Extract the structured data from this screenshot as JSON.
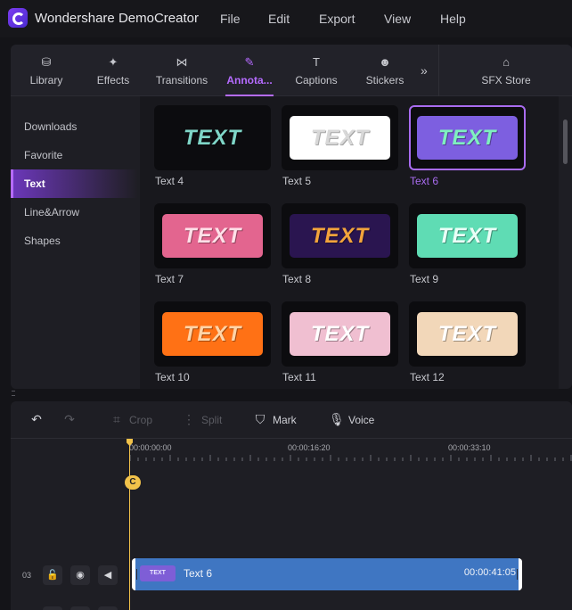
{
  "app": {
    "title": "Wondershare DemoCreator"
  },
  "menu": [
    "File",
    "Edit",
    "Export",
    "View",
    "Help"
  ],
  "tabs": [
    {
      "label": "Library",
      "icon": "layers-icon",
      "glyph": "⛁"
    },
    {
      "label": "Effects",
      "icon": "sparkle-icon",
      "glyph": "✦"
    },
    {
      "label": "Transitions",
      "icon": "bowtie-icon",
      "glyph": "⋈"
    },
    {
      "label": "Annota...",
      "icon": "annotation-icon",
      "glyph": "✎",
      "active": true
    },
    {
      "label": "Captions",
      "icon": "caption-icon",
      "glyph": "T"
    },
    {
      "label": "Stickers",
      "icon": "smiley-icon",
      "glyph": "☻"
    }
  ],
  "more_tabs_glyph": "»",
  "sfx_store": {
    "label": "SFX Store",
    "icon": "store-icon",
    "glyph": "⌂"
  },
  "sidebar": [
    {
      "label": "Downloads"
    },
    {
      "label": "Favorite"
    },
    {
      "label": "Text",
      "active": true
    },
    {
      "label": "Line&Arrow"
    },
    {
      "label": "Shapes"
    }
  ],
  "text_presets": [
    {
      "name": "Text 4",
      "plate_text": "TEXT",
      "plate_bg": "transparent",
      "text_color": "#7fd6c8"
    },
    {
      "name": "Text 5",
      "plate_text": "TEXT",
      "plate_bg": "#ffffff",
      "text_color": "#d8d8d8"
    },
    {
      "name": "Text 6",
      "plate_text": "TEXT",
      "plate_bg": "#7d5fe0",
      "text_color": "#7ff0bf",
      "selected": true
    },
    {
      "name": "Text 7",
      "plate_text": "TEXT",
      "plate_bg": "#e3658f",
      "text_color": "#ffe0e8"
    },
    {
      "name": "Text 8",
      "plate_text": "TEXT",
      "plate_bg": "#2a1550",
      "text_color": "#f2a43b"
    },
    {
      "name": "Text 9",
      "plate_text": "TEXT",
      "plate_bg": "#5fdcb4",
      "text_color": "#eafff7"
    },
    {
      "name": "Text 10",
      "plate_text": "TEXT",
      "plate_bg": "#ff7115",
      "text_color": "#ffd4a8"
    },
    {
      "name": "Text 11",
      "plate_text": "TEXT",
      "plate_bg": "#f0bfd1",
      "text_color": "#ffffff"
    },
    {
      "name": "Text 12",
      "plate_text": "TEXT",
      "plate_bg": "#f2d7b9",
      "text_color": "#ffffff"
    }
  ],
  "toolbar": {
    "undo_glyph": "↶",
    "redo_glyph": "↷",
    "crop": {
      "label": "Crop",
      "glyph": "⌗"
    },
    "split": {
      "label": "Split",
      "glyph": "⋮"
    },
    "mark": {
      "label": "Mark",
      "glyph": "⛉"
    },
    "voice": {
      "label": "Voice",
      "glyph": "🎙"
    }
  },
  "ruler": [
    "00:00:00:00",
    "00:00:16:20",
    "00:00:33:10"
  ],
  "playhead_flag": "C",
  "track": {
    "number": "03",
    "lock_glyph": "🔓",
    "eye_glyph": "◉",
    "audio_glyph": "◀"
  },
  "clip": {
    "name": "Text 6",
    "duration": "00:00:41:05",
    "thumb_text": "TEXT"
  },
  "colors": {
    "accent": "#b56bff",
    "selected_border": "#a96cf0",
    "clip_blue": "#3f76c2",
    "playhead": "#f1c24a"
  }
}
